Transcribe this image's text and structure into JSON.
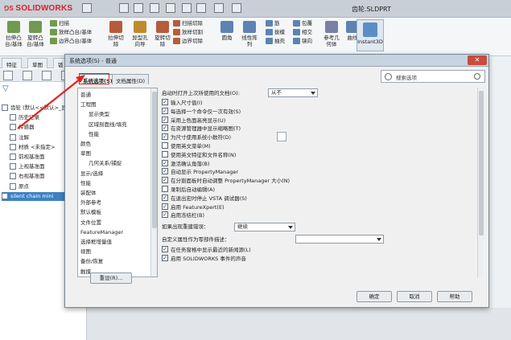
{
  "app": {
    "brand": "SOLIDWORKS",
    "doc_title": "齿轮.SLDPRT"
  },
  "ribbon": {
    "big": [
      {
        "label": "拉伸凸\n台/基体",
        "icon": "extrude-boss-icon"
      },
      {
        "label": "旋转凸\n台/基体",
        "icon": "revolve-boss-icon"
      },
      {
        "label": "拉伸切\n除",
        "icon": "extrude-cut-icon"
      },
      {
        "label": "异型孔\n向导",
        "icon": "hole-wizard-icon"
      },
      {
        "label": "旋转切\n除",
        "icon": "revolve-cut-icon"
      },
      {
        "label": "圆角",
        "icon": "fillet-icon"
      },
      {
        "label": "线性阵\n列",
        "icon": "linear-pattern-icon"
      },
      {
        "label": "参考几\n何体",
        "icon": "reference-geometry-icon"
      },
      {
        "label": "曲线",
        "icon": "curves-icon"
      }
    ],
    "small": [
      "扫描",
      "放样凸台/基体",
      "边界凸台/基体",
      "扫描切除",
      "放样切割",
      "边界切除",
      "筋",
      "拔模",
      "抽壳",
      "包覆",
      "相交",
      "镜向"
    ],
    "instant3d": "Instant3D"
  },
  "tabs": [
    "特征",
    "草图",
    "钣"
  ],
  "tree": [
    "齿轮 (默认<<默认>_显",
    "历史记录",
    "传感器",
    "注解",
    "材质 <未指定>",
    "前视基准面",
    "上视基准面",
    "右视基准面",
    "原点",
    "silent chain mini"
  ],
  "dialog": {
    "title": "系统选项(S) - 普通",
    "close": "✕",
    "tab_system": "系统选项(S)",
    "tab_doc": "文档属性(D)",
    "search_placeholder": "搜索选项",
    "categories": [
      "普通",
      "工程图",
      "显示类型",
      "区域剖面线/填充",
      "性能",
      "颜色",
      "草图",
      "几何关系/捕捉",
      "显示/选择",
      "性能",
      "装配体",
      "外部参考",
      "默认模板",
      "文件位置",
      "FeatureManager",
      "选择框增量值",
      "视图",
      "备份/恢复",
      "触摸"
    ],
    "open_label": "启动时打开上次所使用的文档(O):",
    "open_value": "从不",
    "options": [
      {
        "label": "输入尺寸值(I)",
        "checked": true
      },
      {
        "label": "每选择一个命令仅一次有效(S)",
        "checked": true
      },
      {
        "label": "采用上色面高亮显示(U)",
        "checked": true
      },
      {
        "label": "在资源管理器中显示缩略图(T)",
        "checked": true
      },
      {
        "label": "为尺寸使用系统小数符(D)",
        "checked": true
      },
      {
        "label": "使用英文菜单(M)",
        "checked": false
      },
      {
        "label": "使用英文特征和文件名称(N)",
        "checked": false
      },
      {
        "label": "激活确认角落(B)",
        "checked": true
      },
      {
        "label": "自动显示 PropertyManager",
        "checked": true
      },
      {
        "label": "在分割面板时自动调整 PropertyManager 大小(N)",
        "checked": true
      },
      {
        "label": "录制后自动编辑(A)",
        "checked": false
      },
      {
        "label": "在退出宏时停止 VSTA 调试器(S)",
        "checked": true
      },
      {
        "label": "启用 FeatureXpert(E)",
        "checked": true
      },
      {
        "label": "启用冻结栏(B)",
        "checked": true
      }
    ],
    "rebuild_label": "如果出现重建错误：",
    "rebuild_value": "继续",
    "custom_prop_label": "自定义属性作为零部件描述：",
    "custom_prop_value": "",
    "options2": [
      {
        "label": "在任务窗格中显示最近的新闻源(L)",
        "checked": true
      },
      {
        "label": "启用 SOLIDWORKS 事件的声音",
        "checked": true
      }
    ],
    "reset": "重设(R)...",
    "ok": "确定",
    "cancel": "取消",
    "help": "帮助"
  }
}
